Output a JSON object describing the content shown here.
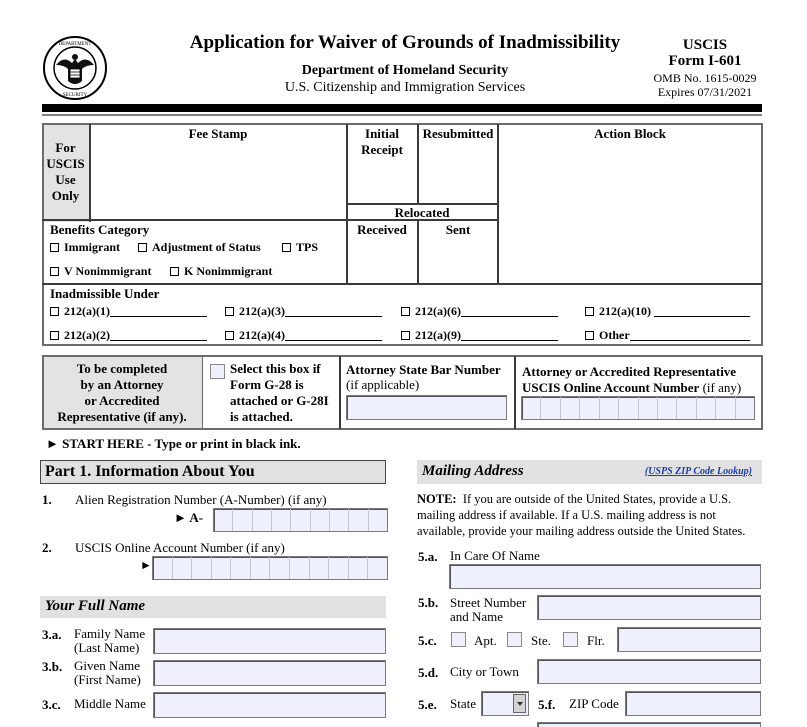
{
  "header": {
    "seal_icon": "dhs-seal-icon",
    "title": "Application for Waiver of Grounds of Inadmissibility",
    "department": "Department of Homeland Security",
    "agency": "U.S. Citizenship and Immigration Services",
    "agency_short": "USCIS",
    "form_number": "Form I-601",
    "omb": "OMB No. 1615-0029",
    "expires": "Expires 07/31/2021"
  },
  "uscis_block": {
    "use_only": [
      "For",
      "USCIS",
      "Use",
      "Only"
    ],
    "fee_stamp": "Fee Stamp",
    "initial_receipt": [
      "Initial",
      "Receipt"
    ],
    "resubmitted": "Resubmitted",
    "action_block": "Action Block",
    "relocated": "Relocated",
    "received": "Received",
    "sent": "Sent",
    "benefits_title": "Benefits Category",
    "benefits": [
      "Immigrant",
      "Adjustment of Status",
      "TPS",
      "V Nonimmigrant",
      "K Nonimmigrant"
    ],
    "inadmissible_title": "Inadmissible Under",
    "inadmissible": [
      "212(a)(1)",
      "212(a)(3)",
      "212(a)(6)",
      "212(a)(10)",
      "212(a)(2)",
      "212(a)(4)",
      "212(a)(9)",
      "Other"
    ]
  },
  "attorney_block": {
    "to_be_completed": [
      "To be completed",
      "by an Attorney",
      "or Accredited",
      "Representative (if any)."
    ],
    "g28_text": [
      "Select this box if",
      "Form G-28 is",
      "attached or G-28I",
      "is attached."
    ],
    "bar_label": "Attorney State Bar Number",
    "bar_note": "(if applicable)",
    "bar_value": "",
    "account_label_1": "Attorney or Accredited Representative",
    "account_label_2": "USCIS Online Account Number",
    "account_note": "(if any)",
    "account_cells": 12
  },
  "start_here": "► START HERE - Type or print in black ink.",
  "part1": {
    "title": "Part 1.  Information About You",
    "q1_num": "1.",
    "q1_label": "Alien Registration Number (A-Number) (if any)",
    "q1_prefix": "► A-",
    "q1_cells": 9,
    "q2_num": "2.",
    "q2_label": "USCIS Online Account Number (if any)",
    "q2_prefix": "►",
    "q2_cells": 12,
    "full_name_title": "Your Full Name",
    "q3a_num": "3.a.",
    "q3a_label": [
      "Family Name",
      "(Last Name)"
    ],
    "q3b_num": "3.b.",
    "q3b_label": [
      "Given Name",
      "(First Name)"
    ],
    "q3c_num": "3.c.",
    "q3c_label": "Middle Name",
    "family_name": "",
    "given_name": "",
    "middle_name": ""
  },
  "mailing": {
    "title": "Mailing Address",
    "zip_link": "(USPS ZIP Code Lookup)",
    "note_bold": "NOTE:",
    "note_lines": [
      "If you are outside of the United States, provide a U.S.",
      "mailing address if available.  If a U.S. mailing address is not",
      "available, provide your mailing address outside the United States."
    ],
    "q5a_num": "5.a.",
    "q5a_label": "In Care Of Name",
    "q5b_num": "5.b.",
    "q5b_label": [
      "Street Number",
      "and Name"
    ],
    "q5c_num": "5.c.",
    "apt": "Apt.",
    "ste": "Ste.",
    "flr": "Flr.",
    "q5d_num": "5.d.",
    "q5d_label": "City or Town",
    "q5e_num": "5.e.",
    "q5e_label": "State",
    "q5f_num": "5.f.",
    "q5f_label": "ZIP Code",
    "state_value": ""
  }
}
